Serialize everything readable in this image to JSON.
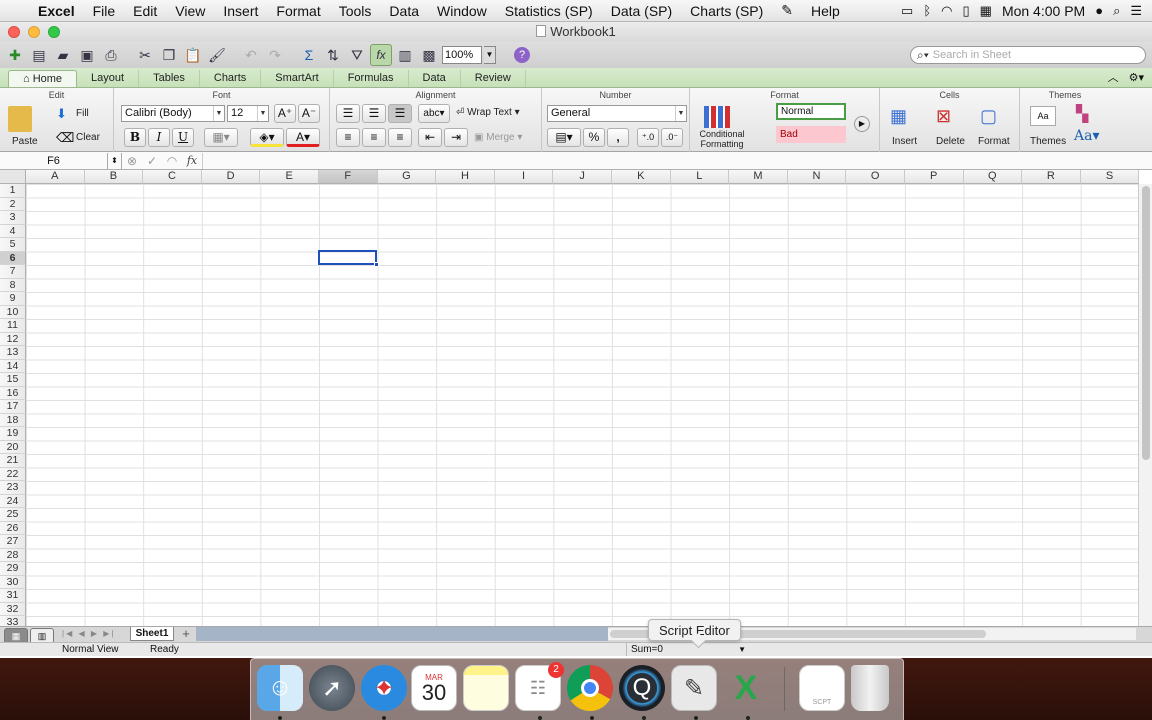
{
  "menubar": {
    "app": "Excel",
    "items": [
      "File",
      "Edit",
      "View",
      "Insert",
      "Format",
      "Tools",
      "Data",
      "Window",
      "Statistics (SP)",
      "Data (SP)",
      "Charts (SP)",
      "Help"
    ],
    "clock": "Mon 4:00 PM"
  },
  "window": {
    "title": "Workbook1"
  },
  "toolbar": {
    "zoom": "100%",
    "search_placeholder": "Search in Sheet"
  },
  "ribbon_tabs": [
    "Home",
    "Layout",
    "Tables",
    "Charts",
    "SmartArt",
    "Formulas",
    "Data",
    "Review"
  ],
  "ribbon": {
    "groups": {
      "edit": "Edit",
      "font": "Font",
      "alignment": "Alignment",
      "number": "Number",
      "format": "Format",
      "cells": "Cells",
      "themes": "Themes"
    },
    "paste_label": "Paste",
    "fill_label": "Fill",
    "clear_label": "Clear",
    "font_name": "Calibri (Body)",
    "font_size": "12",
    "bold": "B",
    "italic": "I",
    "underline": "U",
    "wrap_text": "Wrap Text",
    "wrap_abc": "abc",
    "merge": "Merge",
    "number_format": "General",
    "percent": "%",
    "comma": ",",
    "cond_format_line1": "Conditional",
    "cond_format_line2": "Formatting",
    "style_normal": "Normal",
    "style_bad": "Bad",
    "insert_label": "Insert",
    "delete_label": "Delete",
    "format_label": "Format",
    "themes_label": "Themes",
    "aa_label": "Aa"
  },
  "formula_bar": {
    "name_box": "F6",
    "fx": "fx",
    "content": ""
  },
  "grid": {
    "columns": [
      "A",
      "B",
      "C",
      "D",
      "E",
      "F",
      "G",
      "H",
      "I",
      "J",
      "K",
      "L",
      "M",
      "N",
      "O",
      "P",
      "Q",
      "R",
      "S"
    ],
    "rows": [
      "1",
      "2",
      "3",
      "4",
      "5",
      "6",
      "7",
      "8",
      "9",
      "10",
      "11",
      "12",
      "13",
      "14",
      "15",
      "16",
      "17",
      "18",
      "19",
      "20",
      "21",
      "22",
      "23",
      "24",
      "25",
      "26",
      "27",
      "28",
      "29",
      "30",
      "31",
      "32",
      "33"
    ],
    "selected_cell": "F6"
  },
  "sheets": {
    "active": "Sheet1"
  },
  "status": {
    "view": "Normal View",
    "state": "Ready",
    "sum": "Sum=0"
  },
  "tooltip": "Script Editor",
  "dock": {
    "calendar_month": "MAR",
    "calendar_day": "30",
    "reminders_badge": "2",
    "script_file_label": "SCPT"
  },
  "colors": {
    "ribbon_tab_bg": "#c6e1b8",
    "selection": "#1f4fb8",
    "style_bad_bg": "#fcc7ce",
    "style_normal_border": "#4a9d45"
  }
}
